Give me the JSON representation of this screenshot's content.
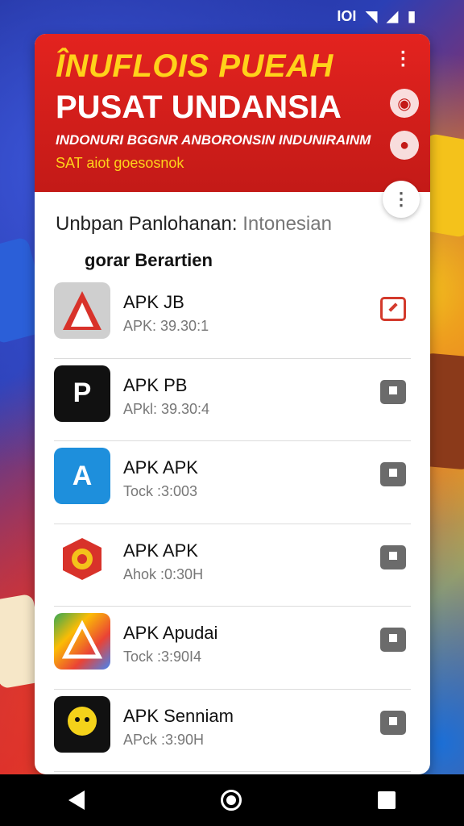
{
  "status_bar": {
    "icons": [
      "signal-icon",
      "wifi-icon",
      "cell-signal-icon",
      "battery-icon"
    ],
    "text": "IOI"
  },
  "header": {
    "title": "ÎNUFLOIS PUEAH",
    "subtitle": "PUSAT UNDANSIA",
    "line1": "INDONURI BGGNR ANBORONSIN INDUNIRAINM",
    "line2": "SAT aiot goesosnok",
    "colors": {
      "bg": "#d9242a",
      "title": "#ffd21a"
    }
  },
  "section": {
    "title": "Unbpan Panlohanan:",
    "title_muted": "Intonesian",
    "subtitle": "gorar Berartien"
  },
  "apps": [
    {
      "name": "APK JB",
      "meta": "APK: 39.30:1",
      "icon": "red-triangle-icon",
      "checked": true
    },
    {
      "name": "APK PB",
      "meta": "APkl: 39.30:4",
      "icon": "p-logo-icon",
      "checked": false
    },
    {
      "name": "APK APK",
      "meta": "Tock :3:003",
      "icon": "blue-a-icon",
      "checked": false
    },
    {
      "name": "APK APK",
      "meta": "Ahok :0:30H",
      "icon": "red-swirl-icon",
      "checked": false
    },
    {
      "name": "APK Apudai",
      "meta": "Tock :3:90I4",
      "icon": "colorful-triangle-icon",
      "checked": false
    },
    {
      "name": "APK Senniam",
      "meta": "APck :3:90H",
      "icon": "yellow-face-icon",
      "checked": false
    }
  ],
  "nav": {
    "back": "back-icon",
    "home": "home-icon",
    "recent": "recent-apps-icon"
  }
}
